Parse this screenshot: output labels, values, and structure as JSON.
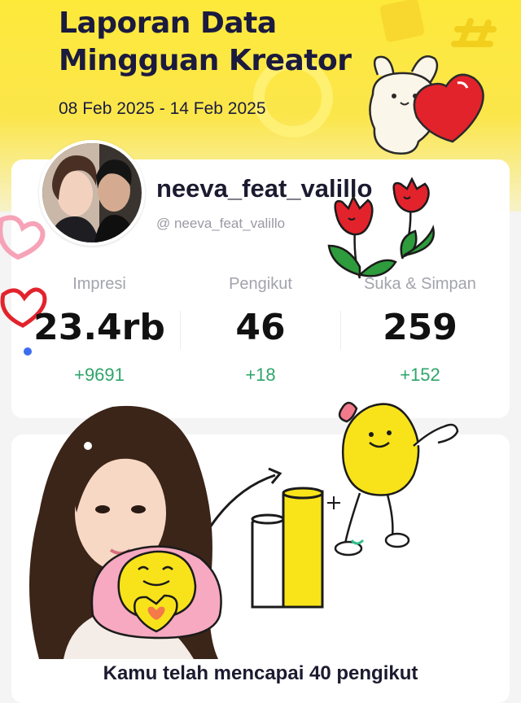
{
  "header": {
    "title_line1": "Laporan Data",
    "title_line2": "Mingguan Kreator",
    "date_range": "08 Feb 2025 - 14 Feb 2025"
  },
  "profile": {
    "username": "neeva_feat_valillo",
    "handle": "@ neeva_feat_valillo"
  },
  "stats": [
    {
      "label": "Impresi",
      "value": "23.4rb",
      "delta": "+9691"
    },
    {
      "label": "Pengikut",
      "value": "46",
      "delta": "+18"
    },
    {
      "label": "Suka & Simpan",
      "value": "259",
      "delta": "+152"
    }
  ],
  "milestone": {
    "text": "Kamu telah mencapai 40 pengikut"
  },
  "colors": {
    "header_yellow": "#fde93a",
    "title_navy": "#1b1a3f",
    "delta_green": "#2fa56b",
    "sticker_red": "#e2232c"
  },
  "icons": [
    "bunny-heart-sticker",
    "tulip-flowers-sticker",
    "heart-doodle-icon",
    "lemon-mascot-sticker",
    "smiley-heart-sticker",
    "growth-bars-illustration"
  ]
}
